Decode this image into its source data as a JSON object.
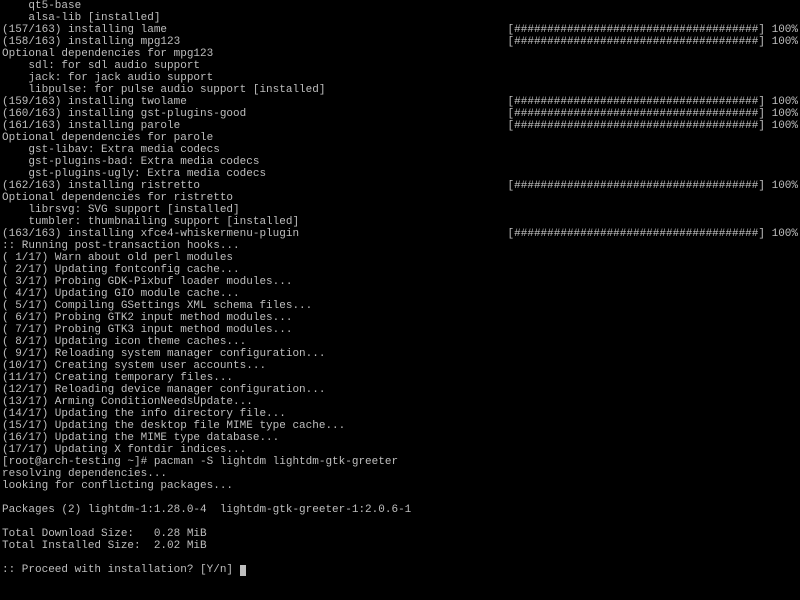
{
  "colors": {
    "bg": "#000000",
    "fg": "#bfbfbf"
  },
  "lines": [
    {
      "l": "    qt5-base",
      "r": ""
    },
    {
      "l": "    alsa-lib [installed]",
      "r": ""
    },
    {
      "l": "(157/163) installing lame",
      "r": "[#####################################] 100%"
    },
    {
      "l": "(158/163) installing mpg123",
      "r": "[#####################################] 100%"
    },
    {
      "l": "Optional dependencies for mpg123",
      "r": ""
    },
    {
      "l": "    sdl: for sdl audio support",
      "r": ""
    },
    {
      "l": "    jack: for jack audio support",
      "r": ""
    },
    {
      "l": "    libpulse: for pulse audio support [installed]",
      "r": ""
    },
    {
      "l": "(159/163) installing twolame",
      "r": "[#####################################] 100%"
    },
    {
      "l": "(160/163) installing gst-plugins-good",
      "r": "[#####################################] 100%"
    },
    {
      "l": "(161/163) installing parole",
      "r": "[#####################################] 100%"
    },
    {
      "l": "Optional dependencies for parole",
      "r": ""
    },
    {
      "l": "    gst-libav: Extra media codecs",
      "r": ""
    },
    {
      "l": "    gst-plugins-bad: Extra media codecs",
      "r": ""
    },
    {
      "l": "    gst-plugins-ugly: Extra media codecs",
      "r": ""
    },
    {
      "l": "(162/163) installing ristretto",
      "r": "[#####################################] 100%"
    },
    {
      "l": "Optional dependencies for ristretto",
      "r": ""
    },
    {
      "l": "    librsvg: SVG support [installed]",
      "r": ""
    },
    {
      "l": "    tumbler: thumbnailing support [installed]",
      "r": ""
    },
    {
      "l": "(163/163) installing xfce4-whiskermenu-plugin",
      "r": "[#####################################] 100%"
    },
    {
      "l": ":: Running post-transaction hooks...",
      "r": ""
    },
    {
      "l": "( 1/17) Warn about old perl modules",
      "r": ""
    },
    {
      "l": "( 2/17) Updating fontconfig cache...",
      "r": ""
    },
    {
      "l": "( 3/17) Probing GDK-Pixbuf loader modules...",
      "r": ""
    },
    {
      "l": "( 4/17) Updating GIO module cache...",
      "r": ""
    },
    {
      "l": "( 5/17) Compiling GSettings XML schema files...",
      "r": ""
    },
    {
      "l": "( 6/17) Probing GTK2 input method modules...",
      "r": ""
    },
    {
      "l": "( 7/17) Probing GTK3 input method modules...",
      "r": ""
    },
    {
      "l": "( 8/17) Updating icon theme caches...",
      "r": ""
    },
    {
      "l": "( 9/17) Reloading system manager configuration...",
      "r": ""
    },
    {
      "l": "(10/17) Creating system user accounts...",
      "r": ""
    },
    {
      "l": "(11/17) Creating temporary files...",
      "r": ""
    },
    {
      "l": "(12/17) Reloading device manager configuration...",
      "r": ""
    },
    {
      "l": "(13/17) Arming ConditionNeedsUpdate...",
      "r": ""
    },
    {
      "l": "(14/17) Updating the info directory file...",
      "r": ""
    },
    {
      "l": "(15/17) Updating the desktop file MIME type cache...",
      "r": ""
    },
    {
      "l": "(16/17) Updating the MIME type database...",
      "r": ""
    },
    {
      "l": "(17/17) Updating X fontdir indices...",
      "r": ""
    },
    {
      "l": "[root@arch-testing ~]# pacman -S lightdm lightdm-gtk-greeter",
      "r": ""
    },
    {
      "l": "resolving dependencies...",
      "r": ""
    },
    {
      "l": "looking for conflicting packages...",
      "r": ""
    },
    {
      "l": "",
      "r": ""
    },
    {
      "l": "Packages (2) lightdm-1:1.28.0-4  lightdm-gtk-greeter-1:2.0.6-1",
      "r": ""
    },
    {
      "l": "",
      "r": ""
    },
    {
      "l": "Total Download Size:   0.28 MiB",
      "r": ""
    },
    {
      "l": "Total Installed Size:  2.02 MiB",
      "r": ""
    },
    {
      "l": "",
      "r": ""
    },
    {
      "l": ":: Proceed with installation? [Y/n] ",
      "r": "",
      "cursor": true
    }
  ],
  "prompt": {
    "user": "root",
    "host": "arch-testing",
    "cwd": "~",
    "command": "pacman -S lightdm lightdm-gtk-greeter"
  },
  "packages": [
    "lightdm-1:1.28.0-4",
    "lightdm-gtk-greeter-1:2.0.6-1"
  ],
  "sizes": {
    "download": "0.28 MiB",
    "installed": "2.02 MiB"
  },
  "confirm_prompt": ":: Proceed with installation? [Y/n]"
}
